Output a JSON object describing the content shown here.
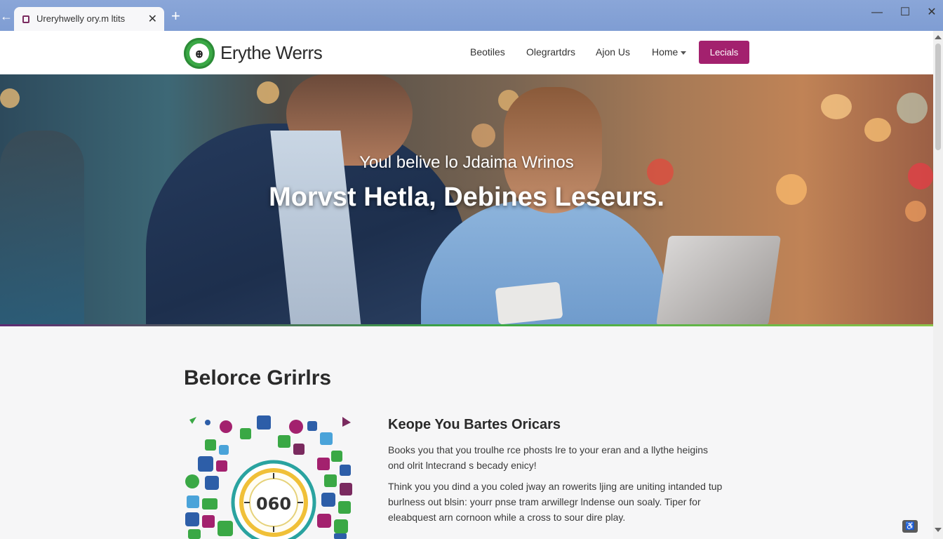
{
  "browser": {
    "tab_title": "Ureryhwelly ory.m ltits",
    "new_tab_label": "+",
    "back_label": "←",
    "close_tab_label": "✕",
    "window_controls": {
      "minimize": "—",
      "maximize": "☐",
      "close": "✕"
    }
  },
  "site": {
    "brand": "Erythe Werrs",
    "logo_icon": "tree-logo-icon",
    "brand_color": "#3aa845",
    "accent_color": "#a3216e",
    "nav": [
      {
        "label": "Beotiles"
      },
      {
        "label": "Olegrartdrs"
      },
      {
        "label": "Ajon Us"
      },
      {
        "label": "Home",
        "has_dropdown": true
      }
    ],
    "cta_label": "Lecials"
  },
  "hero": {
    "subtitle": "Youl belive lo Jdaima Wrinos",
    "title": "Morvst Hetla, Debines Leseurs."
  },
  "section": {
    "heading": "Belorce Grirlrs",
    "art_center_text": "060",
    "feature_title": "Keope You Bartes Oricars",
    "paragraph1": [
      "Books you that you troulhe rce phosts lre to your eran and a llythe heigins",
      "ond olrit lntecrand s becady enicy!"
    ],
    "paragraph2": [
      "Think you you dind a you coled jway an rowerits ljing are uniting intanded tup",
      "burlness out blsin: yourr pnse tram arwillegr lndense oun soaly. Tiper for",
      "eleabquest arn cornoon while a cross to sour dire play."
    ]
  }
}
